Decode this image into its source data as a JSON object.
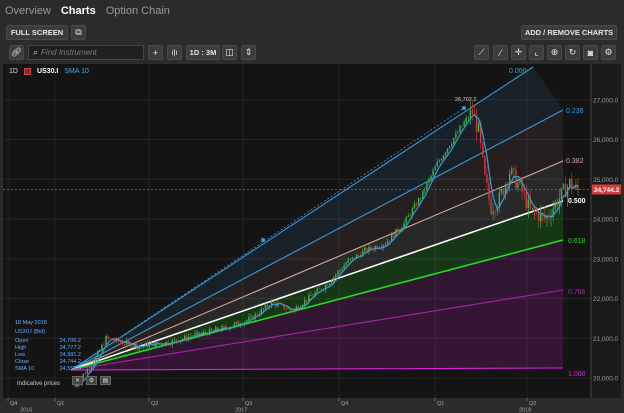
{
  "tabs": [
    {
      "label": "Overview",
      "active": false
    },
    {
      "label": "Charts",
      "active": true
    },
    {
      "label": "Option Chain",
      "active": false
    }
  ],
  "toolbar": {
    "full_screen_label": "FULL SCREEN",
    "add_remove_label": "ADD / REMOVE CHARTS"
  },
  "toolbar2": {
    "search_placeholder": "Find Instrument",
    "period_label": "1D : 3M",
    "right_icons": [
      "trend-line-icon",
      "line-tool-icon",
      "crosshair-icon",
      "curve-tool-icon",
      "zoom-icon",
      "refresh-icon",
      "camera-icon",
      "settings-icon"
    ]
  },
  "chart_header": {
    "timeframe": "1D",
    "symbol": "US30.I",
    "indicator": "SMA 10"
  },
  "ohlc_panel": {
    "date": "18 May 2018",
    "instrument": "US30.I (Bid)",
    "rows": [
      {
        "label": "Open",
        "value": "24,706.2"
      },
      {
        "label": "High",
        "value": "24,777.2"
      },
      {
        "label": "Low",
        "value": "24,581.2"
      },
      {
        "label": "Close",
        "value": "24,744.2"
      },
      {
        "label": "SMA 10",
        "value": "24,555.3"
      }
    ],
    "note": "Indicative prices"
  },
  "chart_data": {
    "type": "candlestick",
    "instrument": "US30.I",
    "last_price": "24,744.2",
    "peak_label": "26,702.2",
    "y_ticks": [
      "27,000.0",
      "26,000.0",
      "25,000.0",
      "24,000.0",
      "23,000.0",
      "22,000.0",
      "21,000.0",
      "20,000.0"
    ],
    "ylim": [
      19500,
      27900
    ],
    "x_ticks_top": [
      "Q4",
      "Q1",
      "Q2",
      "Q3",
      "Q4",
      "Q1",
      "Q2"
    ],
    "x_ticks_bottom": [
      "2016",
      "2017",
      "2018"
    ],
    "fib_fan_levels": [
      "0.000",
      "0.236",
      "0.382",
      "0.500",
      "0.618",
      "0.786",
      "1.000"
    ],
    "colors": {
      "fib_0": "#3a9ad9",
      "fib_236": "#3a9ad9",
      "fib_382": "#d9a8a0",
      "fib_500": "#ffffff",
      "fib_618": "#22dd22",
      "fib_786": "#aa22aa",
      "fib_1000": "#dd22dd",
      "up": "#3cb84a",
      "down": "#d63b3b",
      "sma": "#3a9ad9",
      "last_price_bg": "#d63b3b"
    }
  }
}
